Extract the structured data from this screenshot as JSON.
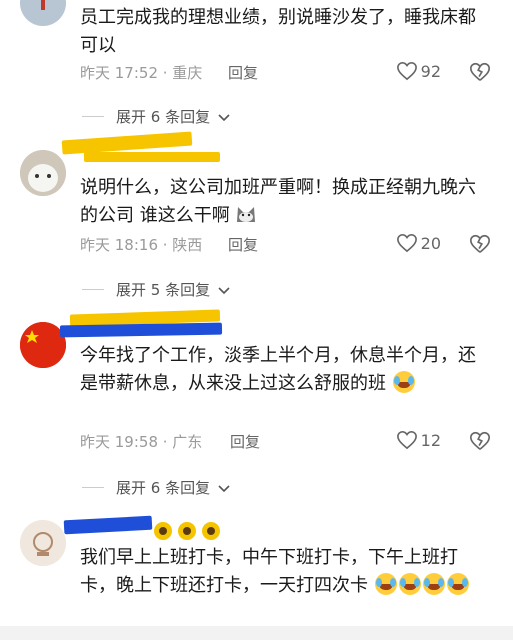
{
  "comments": [
    {
      "text": "员工完成我的理想业绩，别说睡沙发了，睡我床都可以",
      "time_location": "昨天 17:52 · 重庆",
      "reply_label": "回复",
      "likes": "92"
    },
    {
      "text": "说明什么，这公司加班严重啊！换成正经朝九晚六的公司 谁这么干啊",
      "time_location": "昨天 18:16 · 陕西",
      "reply_label": "回复",
      "likes": "20"
    },
    {
      "text": "今年找了个工作，淡季上半个月，休息半个月，还是带薪休息，从来没上过这么舒服的班",
      "time_location": "昨天 19:58 · 广东",
      "reply_label": "回复",
      "likes": "12"
    },
    {
      "text": "我们早上上班打卡，中午下班打卡，下午上班打卡，晚上下班还打卡，一天打四次卡"
    }
  ],
  "expand_replies": [
    "展开 6 条回复",
    "展开 5 条回复",
    "展开 6 条回复"
  ],
  "colors": {
    "redact_yellow": "#f7c400",
    "redact_blue": "#1f4fd8",
    "meta_gray": "#9a9a9a"
  }
}
